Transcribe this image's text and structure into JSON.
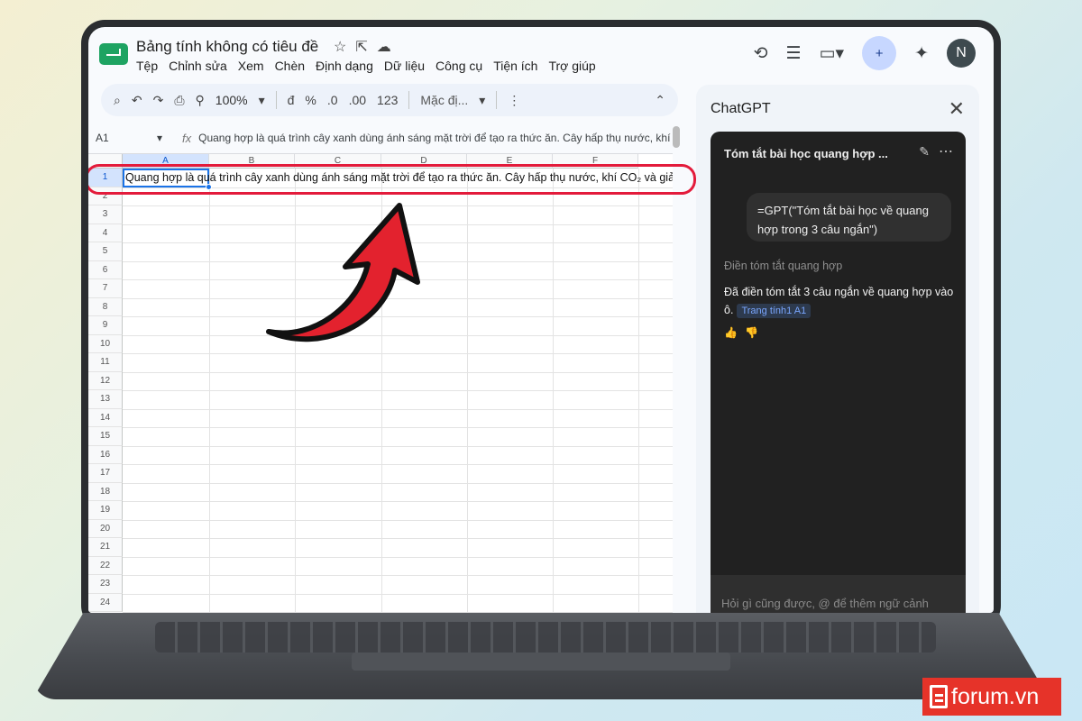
{
  "sheet": {
    "title": "Bảng tính không có tiêu đề",
    "menu": [
      "Tệp",
      "Chỉnh sửa",
      "Xem",
      "Chèn",
      "Định dạng",
      "Dữ liệu",
      "Công cụ",
      "Tiện ích",
      "Trợ giúp"
    ],
    "toolbar": {
      "zoom": "100%",
      "currency": "đ",
      "percent": "%",
      "dec_decrease": ".0",
      "dec_increase": ".00",
      "number_format": "123",
      "font": "Mặc đị..."
    },
    "name_box": "A1",
    "formula_text": "Quang hợp là quá trình cây xanh dùng ánh sáng mặt trời để tạo ra thức ăn. Cây hấp thụ nước, khí",
    "columns": [
      "A",
      "B",
      "C",
      "D",
      "E",
      "F"
    ],
    "rows": [
      "1",
      "2",
      "3",
      "4",
      "5",
      "6",
      "7",
      "8",
      "9",
      "10",
      "11",
      "12",
      "13",
      "14",
      "15",
      "16",
      "17",
      "18",
      "19",
      "20",
      "21",
      "22",
      "23",
      "24"
    ],
    "cell_a1": "Quang hợp là quá trình cây xanh dùng ánh sáng mặt trời để tạo ra thức ăn. Cây hấp thụ nước, khí CO₂ và giả"
  },
  "panel": {
    "title": "ChatGPT",
    "chat_title": "Tóm tắt bài học quang hợp ...",
    "user_prompt": "=GPT(\"Tóm tắt bài học về quang hợp trong 3 câu ngắn\")",
    "status": "Điền tóm tắt quang hợp",
    "answer": "Đã điền tóm tắt 3 câu ngắn về quang hợp vào ô.",
    "answer_ref": "Trang tính1 A1",
    "input_placeholder": "Hỏi gì cũng được, @ để thêm ngữ cảnh"
  },
  "watermark": {
    "text": "forum.vn"
  },
  "colors": {
    "accent_red": "#e31b3b",
    "selection_blue": "#1a73e8",
    "chat_bg": "#212121"
  },
  "icons": [
    "search-icon",
    "undo-icon",
    "redo-icon",
    "print-icon",
    "paint-format-icon",
    "history-icon",
    "comment-icon",
    "video-icon",
    "share-icon",
    "gemini-icon",
    "close-icon",
    "edit-icon",
    "more-icon",
    "thumb-up-icon",
    "thumb-down-icon",
    "star-icon",
    "folder-icon",
    "cloud-icon"
  ]
}
